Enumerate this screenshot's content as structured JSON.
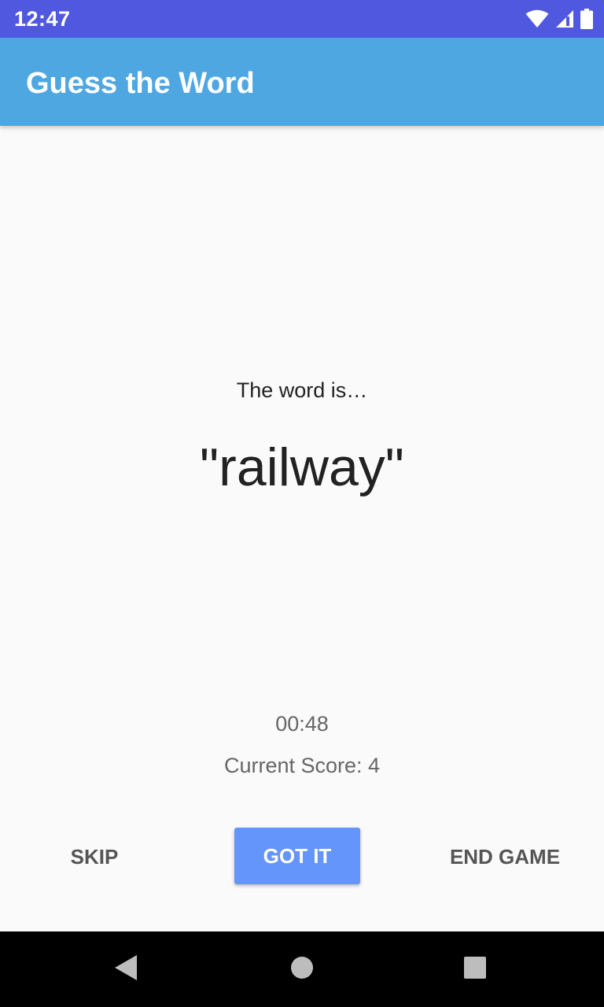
{
  "status_bar": {
    "time": "12:47",
    "background": "#5058e0",
    "icons": [
      "wifi-icon",
      "cell-signal-icon",
      "battery-icon"
    ]
  },
  "app_bar": {
    "title": "Guess the Word",
    "background": "#4fa7e2"
  },
  "game": {
    "intro_text": "The word is…",
    "word": "\"railway\"",
    "timer": "00:48",
    "score_text": "Current Score: 4"
  },
  "buttons": {
    "skip_label": "SKIP",
    "got_it_label": "GOT IT",
    "end_game_label": "END GAME",
    "accent": "#6495fb"
  },
  "nav_bar": {
    "icons": [
      "back-icon",
      "home-icon",
      "recents-icon"
    ]
  }
}
